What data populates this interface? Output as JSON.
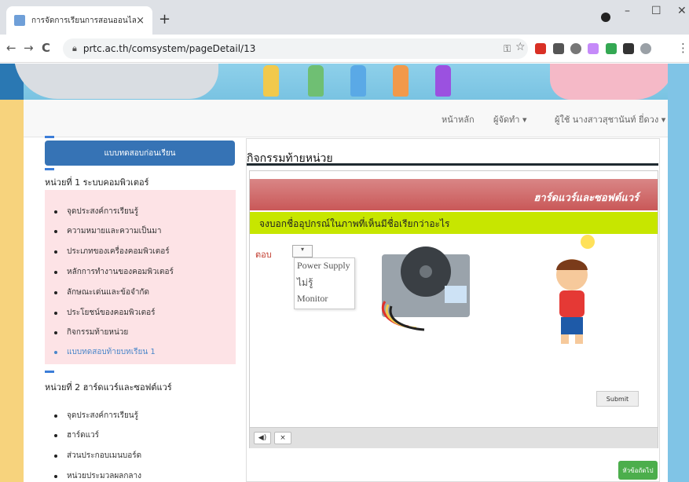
{
  "browser": {
    "tab_title": "การจัดการเรียนการสอนออนไลน์",
    "tab_close": "×",
    "new_tab": "+",
    "url": "prtc.ac.th/comsystem/pageDetail/13",
    "back": "←",
    "forward": "→",
    "reload": "C",
    "minimize": "–",
    "maximize": "☐",
    "close": "✕",
    "key_icon": "⚿",
    "star_icon": "☆",
    "menu_icon": "⋮"
  },
  "navbar": {
    "home": "หน้าหลัก",
    "admin": "ผู้จัดทำ ▾",
    "user": "ผู้ใช้ นางสาวสุชานันท์ ยี่ดวง ▾"
  },
  "sidebar": {
    "pretest_button": "แบบทดสอบก่อนเรียน",
    "unit1": {
      "heading": "หน่วยที่ 1 ระบบคอมพิวเตอร์",
      "items": [
        "จุดประสงค์การเรียนรู้",
        "ความหมายและความเป็นมา",
        "ประเภทของเครื่องคอมพิวเตอร์",
        "หลักการทำงานของคอมพิวเตอร์",
        "ลักษณะเด่นและข้อจำกัด",
        "ประโยชน์ของคอมพิวเตอร์",
        "กิจกรรมท้ายหน่วย",
        "แบบทดสอบท้ายบทเรียน 1"
      ]
    },
    "unit2": {
      "heading": "หน่วยที่ 2 ฮาร์ดแวร์และซอฟต์แวร์",
      "items": [
        "จุดประสงค์การเรียนรู้",
        "ฮาร์ดแวร์",
        "ส่วนประกอบเมนบอร์ด",
        "หน่วยประมวลผลกลาง"
      ]
    }
  },
  "main": {
    "title": "กิจกรรมท้ายหน่วย",
    "frame_header": "ฮาร์ดแวร์และซอฟต์แวร์",
    "question": "จงบอกชื่ออุปกรณ์ในภาพที่เห็นมีชื่อเรียกว่าอะไร",
    "answer_label": "ตอบ",
    "select_arrow": "▾",
    "options": [
      "Power Supply",
      "ไม่รู้",
      "Monitor"
    ],
    "submit": "Submit",
    "audio_icon": "◀)",
    "close_icon": "×",
    "next_button": "หัวข้อถัดไป"
  },
  "colors": {
    "pretest_button": "#3673b5",
    "unit_highlight": "#fde3e6",
    "question_bar": "#c7e600",
    "frame_header": "#c95858",
    "next_button": "#4cae4c",
    "active_item": "#4a86c9"
  }
}
